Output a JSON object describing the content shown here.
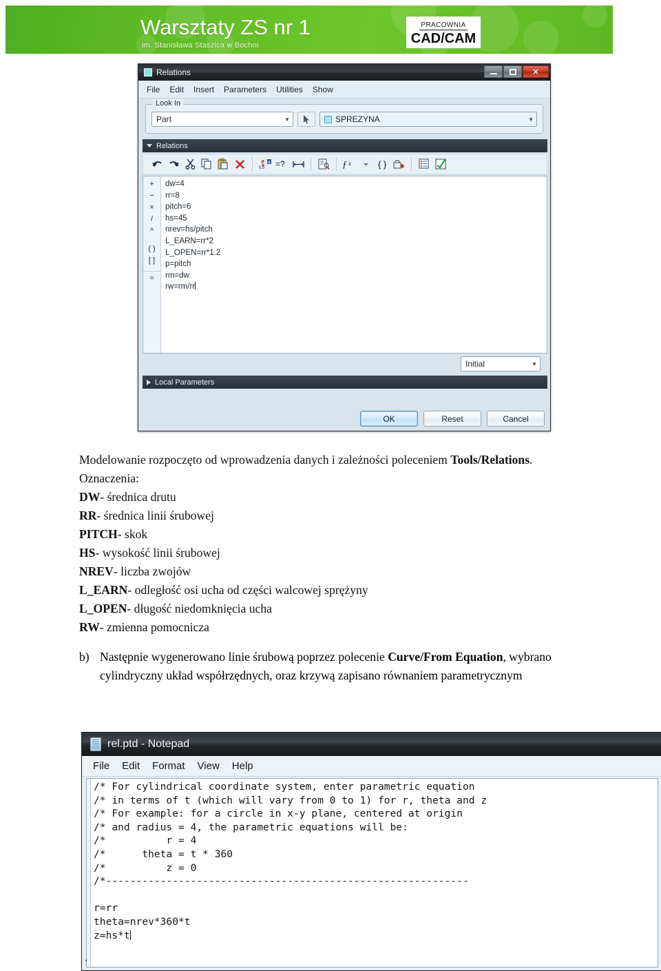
{
  "banner": {
    "title": "Warsztaty ZS nr 1",
    "subtitle": "im. Stanisława Staszica w Bochni",
    "logo_top": "PRACOWNIA",
    "logo_main": "CAD/CAM",
    "accent_color": "#63bd27"
  },
  "relations_dialog": {
    "window_title": "Relations",
    "window_buttons": {
      "minimize": "minimize-button",
      "maximize": "maximize-button",
      "close": "✕"
    },
    "menu": [
      "File",
      "Edit",
      "Insert",
      "Parameters",
      "Utilities",
      "Show"
    ],
    "look_in": {
      "legend": "Look In",
      "type_value": "Part",
      "model_value": "SPREZYNA",
      "caret": "▼"
    },
    "panel": {
      "header": "Relations",
      "toolbar_icons": [
        "undo-icon",
        "redo-icon",
        "cut-icon",
        "copy-icon",
        "paste-icon",
        "delete-icon",
        "switch-dimensions-icon",
        "verify-icon",
        "dimension-icon",
        "relation-info-icon",
        "function-icon",
        "function-dropdown-icon",
        "units-icon",
        "lock-icon",
        "parameters-icon",
        "check-icon"
      ],
      "operators": [
        "+",
        "−",
        "×",
        "/",
        "^",
        "( )",
        "[ ]",
        "="
      ],
      "relations_text": "dw=4\nrr=8\npitch=6\nhs=45\nnrev=hs/pitch\nL_EARN=rr*2\nL_OPEN=rr*1.2\np=pitch\nrm=dw\nrw=rm/rr"
    },
    "initial_value": "Initial",
    "local_parameters": "Local Parameters",
    "buttons": {
      "ok": "OK",
      "reset": "Reset",
      "cancel": "Cancel"
    }
  },
  "document": {
    "para1_a": "Modelowanie rozpoczęto od wprowadzenia danych i zależności poleceniem ",
    "para1_b": "Tools/Relations",
    "para1_c": ".",
    "oznaczenia": "Oznaczenia:",
    "definitions": [
      {
        "term": "DW",
        "desc": "- średnica drutu"
      },
      {
        "term": "RR",
        "desc": "- średnica linii śrubowej"
      },
      {
        "term": "PITCH",
        "desc": "- skok"
      },
      {
        "term": "HS",
        "desc": "- wysokość linii śrubowej"
      },
      {
        "term": "NREV",
        "desc": "- liczba zwojów"
      },
      {
        "term": "L_EARN",
        "desc": "- odległość osi ucha od części walcowej sprężyny"
      },
      {
        "term": "L_OPEN",
        "desc": "- długość niedomknięcia ucha"
      },
      {
        "term": "RW",
        "desc": "- zmienna pomocnicza"
      }
    ],
    "item_b": {
      "marker": "b)",
      "text1": "Następnie wygenerowano linie śrubową poprzez polecenie ",
      "bold1": "Curve/From Equation",
      "text2": ", wybrano cylindryczny układ współrzędnych, oraz krzywą zapisano równaniem parametrycznym"
    }
  },
  "notepad": {
    "window_title": "rel.ptd - Notepad",
    "menu": [
      "File",
      "Edit",
      "Format",
      "View",
      "Help"
    ],
    "content": "/* For cylindrical coordinate system, enter parametric equation\n/* in terms of t (which will vary from 0 to 1) for r, theta and z\n/* For example: for a circle in x-y plane, centered at origin\n/* and radius = 4, the parametric equations will be:\n/*          r = 4\n/*      theta = t * 360\n/*          z = 0\n/*------------------------------------------------------------\n\nr=rr\ntheta=nrev*360*t\nz=hs*t"
  }
}
